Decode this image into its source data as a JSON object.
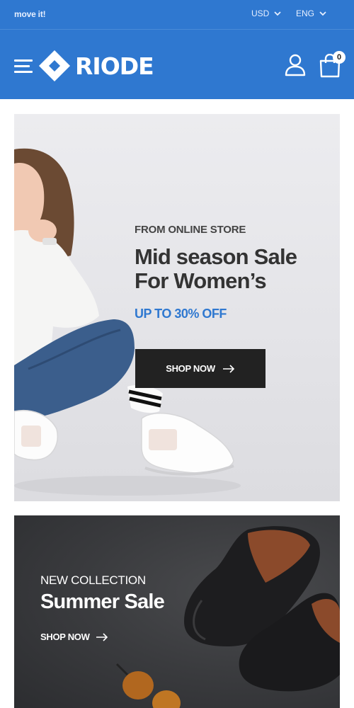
{
  "topbar": {
    "marquee_text": "move it!",
    "currency": "USD",
    "language": "ENG"
  },
  "header": {
    "brand": "RIODE",
    "cart_count": "0"
  },
  "banner_primary": {
    "subtitle": "FROM ONLINE STORE",
    "title_line1": "Mid season Sale",
    "title_line2": "For Women’s",
    "offer": "UP TO 30% OFF",
    "button_label": "SHOP NOW"
  },
  "banner_secondary": {
    "subtitle": "NEW COLLECTION",
    "title": "Summer Sale",
    "link_label": "SHOP NOW"
  },
  "colors": {
    "brand_blue": "#2f78d0",
    "dark_button": "#222222"
  }
}
